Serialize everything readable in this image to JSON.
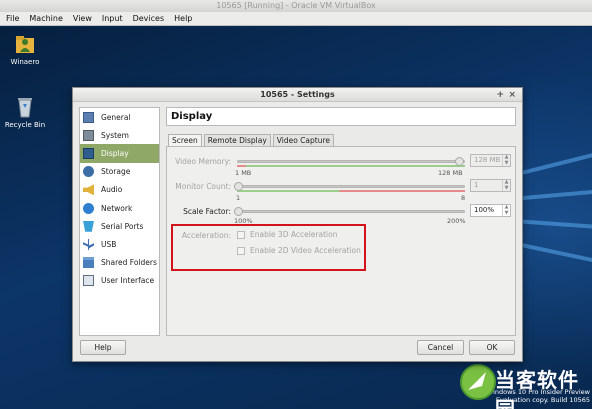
{
  "host": {
    "title": "10565 [Running] - Oracle VM VirtualBox",
    "menu": [
      "File",
      "Machine",
      "View",
      "Input",
      "Devices",
      "Help"
    ]
  },
  "desktop": {
    "icons": [
      {
        "label": "Winaero",
        "icon": "user-folder-icon"
      },
      {
        "label": "Recycle Bin",
        "icon": "recycle-bin-icon"
      }
    ],
    "watermark": [
      "Windows 10 Pro Insider Preview",
      "Evaluation copy. Build 10565"
    ],
    "brand": "当客软件园"
  },
  "dialog": {
    "title": "10565 - Settings",
    "controls": {
      "pin": "+",
      "close": "×"
    },
    "sidebar": [
      {
        "label": "General",
        "icon": "general-icon",
        "selected": false
      },
      {
        "label": "System",
        "icon": "system-icon",
        "selected": false
      },
      {
        "label": "Display",
        "icon": "display-icon",
        "selected": true
      },
      {
        "label": "Storage",
        "icon": "storage-icon",
        "selected": false
      },
      {
        "label": "Audio",
        "icon": "audio-icon",
        "selected": false
      },
      {
        "label": "Network",
        "icon": "network-icon",
        "selected": false
      },
      {
        "label": "Serial Ports",
        "icon": "serial-ports-icon",
        "selected": false
      },
      {
        "label": "USB",
        "icon": "usb-icon",
        "selected": false
      },
      {
        "label": "Shared Folders",
        "icon": "shared-folders-icon",
        "selected": false
      },
      {
        "label": "User Interface",
        "icon": "user-interface-icon",
        "selected": false
      }
    ],
    "section_title": "Display",
    "tabs": [
      {
        "label": "Screen",
        "active": true
      },
      {
        "label": "Remote Display",
        "active": false
      },
      {
        "label": "Video Capture",
        "active": false
      }
    ],
    "screen": {
      "video_memory": {
        "label": "Video Memory:",
        "value": "128 MB",
        "min_label": "1 MB",
        "max_label": "128 MB",
        "level": 1.0
      },
      "monitor_count": {
        "label": "Monitor Count:",
        "value": "1",
        "min_label": "1",
        "max_label": "8",
        "level": 0.0
      },
      "scale_factor": {
        "label": "Scale Factor:",
        "value": "100%",
        "min_label": "100%",
        "max_label": "200%",
        "level": 0.0
      },
      "acceleration": {
        "label": "Acceleration:",
        "options": [
          "Enable 3D Acceleration",
          "Enable 2D Video Acceleration"
        ]
      }
    },
    "buttons": {
      "help": "Help",
      "cancel": "Cancel",
      "ok": "OK"
    }
  },
  "colors": {
    "selection": "#8fa867",
    "highlight_box": "#d3131b",
    "desktop_bg": "#0c3568"
  }
}
